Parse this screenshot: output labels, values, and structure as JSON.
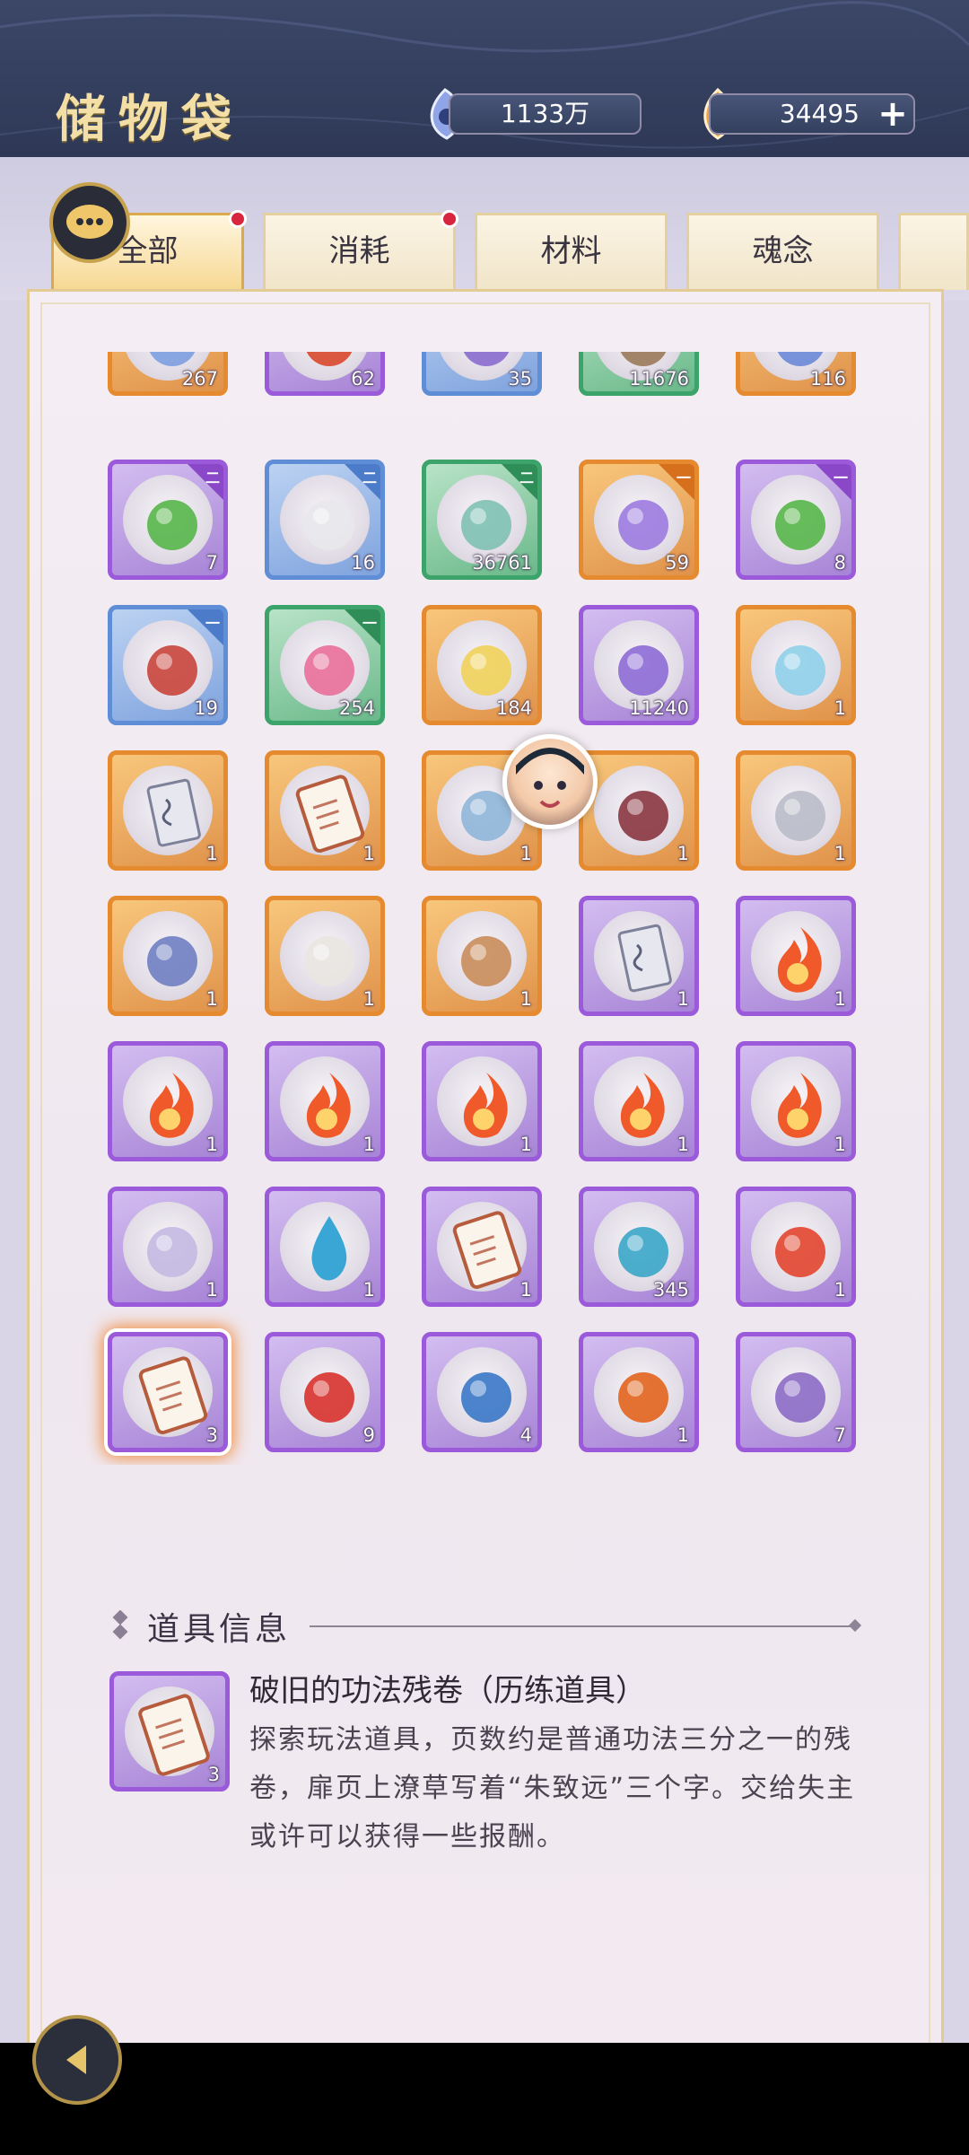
{
  "header": {
    "title": "储物袋",
    "currency_1": {
      "icon": "blue-spirit-stone-icon",
      "value": "1133万"
    },
    "currency_2": {
      "icon": "gold-flame-icon",
      "value": "34495",
      "add_label": "+"
    }
  },
  "tabs": [
    {
      "label": "全部",
      "active": true,
      "badge": true
    },
    {
      "label": "消耗",
      "active": false,
      "badge": true
    },
    {
      "label": "材料",
      "active": false,
      "badge": false
    },
    {
      "label": "魂念",
      "active": false,
      "badge": false
    }
  ],
  "items": {
    "row0": [
      {
        "qty": "267",
        "quality": "orange",
        "icon": "blue-flower-icon"
      },
      {
        "qty": "62",
        "quality": "purple",
        "icon": "red-berry-branch-icon"
      },
      {
        "qty": "35",
        "quality": "blue",
        "icon": "mushroom-icon"
      },
      {
        "qty": "11676",
        "quality": "green",
        "icon": "root-icon"
      },
      {
        "qty": "116",
        "quality": "orange",
        "icon": "lotus-icon"
      }
    ],
    "row1": [
      {
        "qty": "7",
        "quality": "purple",
        "tier": "二",
        "icon": "green-berry-icon"
      },
      {
        "qty": "16",
        "quality": "blue",
        "tier": "二",
        "icon": "white-stone-icon"
      },
      {
        "qty": "36761",
        "quality": "green",
        "tier": "二",
        "icon": "jade-ring-icon"
      },
      {
        "qty": "59",
        "quality": "orange",
        "tier": "一",
        "icon": "purple-crystal-cluster-icon"
      },
      {
        "qty": "8",
        "quality": "purple",
        "tier": "一",
        "icon": "green-berry-icon"
      }
    ],
    "row2": [
      {
        "qty": "19",
        "quality": "blue",
        "tier": "一",
        "icon": "red-coral-tree-icon"
      },
      {
        "qty": "254",
        "quality": "green",
        "tier": "一",
        "icon": "pink-coral-icon"
      },
      {
        "qty": "184",
        "quality": "orange",
        "icon": "yellow-crystal-icon"
      },
      {
        "qty": "11240",
        "quality": "purple",
        "icon": "purple-crystal-icon"
      },
      {
        "qty": "1",
        "quality": "orange",
        "icon": "ice-shards-icon"
      }
    ],
    "row3": [
      {
        "qty": "1",
        "quality": "orange",
        "icon": "paper-talisman-icon"
      },
      {
        "qty": "1",
        "quality": "orange",
        "icon": "scroll-icon"
      },
      {
        "qty": "1",
        "quality": "orange",
        "icon": "jade-pendant-icon"
      },
      {
        "qty": "1",
        "quality": "orange",
        "icon": "dry-branch-icon"
      },
      {
        "qty": "1",
        "quality": "orange",
        "icon": "silver-wings-icon"
      }
    ],
    "row4": [
      {
        "qty": "1",
        "quality": "orange",
        "icon": "ornate-box-icon"
      },
      {
        "qty": "1",
        "quality": "orange",
        "icon": "letter-icon"
      },
      {
        "qty": "1",
        "quality": "orange",
        "icon": "mirror-frame-icon"
      },
      {
        "qty": "1",
        "quality": "purple",
        "icon": "paper-talisman-icon"
      },
      {
        "qty": "1",
        "quality": "purple",
        "icon": "fire-icon"
      }
    ],
    "row5": [
      {
        "qty": "1",
        "quality": "purple",
        "icon": "fire-icon"
      },
      {
        "qty": "1",
        "quality": "purple",
        "icon": "fire-icon"
      },
      {
        "qty": "1",
        "quality": "purple",
        "icon": "fire-icon"
      },
      {
        "qty": "1",
        "quality": "purple",
        "icon": "fire-icon"
      },
      {
        "qty": "1",
        "quality": "purple",
        "icon": "fire-icon"
      }
    ],
    "row6": [
      {
        "qty": "1",
        "quality": "purple",
        "icon": "rolled-scroll-icon"
      },
      {
        "qty": "1",
        "quality": "purple",
        "icon": "water-drop-icon"
      },
      {
        "qty": "1",
        "quality": "purple",
        "icon": "scroll-icon"
      },
      {
        "qty": "345",
        "quality": "purple",
        "icon": "blue-spirit-orb-icon"
      },
      {
        "qty": "1",
        "quality": "purple",
        "icon": "divine-seal-icon"
      }
    ],
    "row7": [
      {
        "qty": "3",
        "quality": "purple",
        "icon": "scroll-icon",
        "selected": true
      },
      {
        "qty": "9",
        "quality": "purple",
        "icon": "red-fire-orb-icon"
      },
      {
        "qty": "4",
        "quality": "purple",
        "icon": "blue-fire-orb-icon"
      },
      {
        "qty": "1",
        "quality": "purple",
        "icon": "orange-fire-orb-icon"
      },
      {
        "qty": "7",
        "quality": "purple",
        "icon": "purple-scroll-icon"
      }
    ]
  },
  "info": {
    "heading": "道具信息",
    "item_qty": "3",
    "item_name": "破旧的功法残卷（历练道具）",
    "item_desc": "探索玩法道具，页数约是普通功法三分之一的残卷，扉页上潦草写着“朱致远”三个字。交给失主或许可以获得一些报酬。"
  },
  "colors": {
    "header_bg": "#34405e",
    "title_gold": "#f3dfa6",
    "quality_orange": "#e58a2e",
    "quality_purple": "#9b5ad9",
    "quality_blue": "#5f8dd6",
    "quality_green": "#3ca46b",
    "badge_red": "#d7263d"
  }
}
